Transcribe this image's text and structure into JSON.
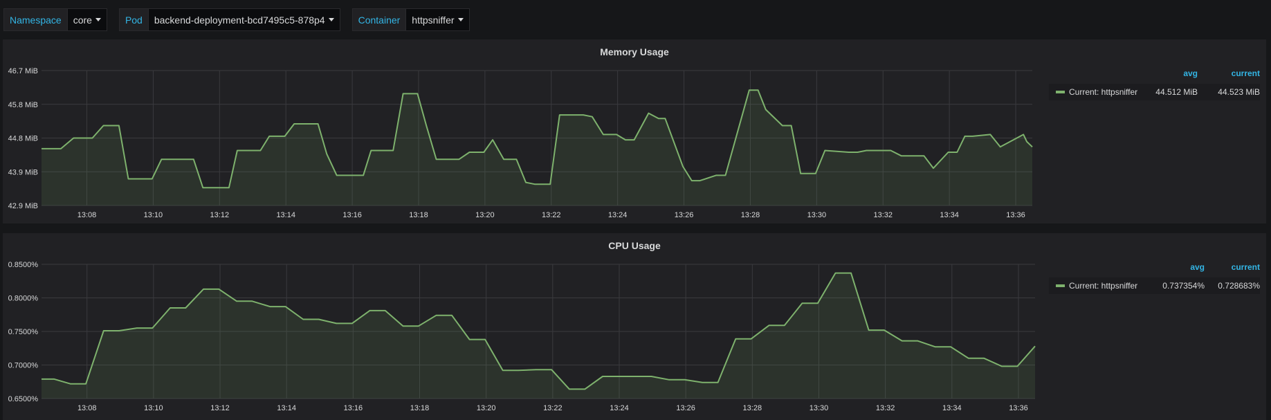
{
  "variables": [
    {
      "label": "Namespace",
      "value": "core"
    },
    {
      "label": "Pod",
      "value": "backend-deployment-bcd7495c5-878p4"
    },
    {
      "label": "Container",
      "value": "httpsniffer"
    }
  ],
  "colors": {
    "series": "#7eb26d",
    "accent": "#33b5e5",
    "grid": "#3a3a3e"
  },
  "legend_headers": {
    "avg": "avg",
    "current": "current"
  },
  "chart_data": [
    {
      "type": "area",
      "title": "Memory Usage",
      "x_ticks": [
        "13:08",
        "13:10",
        "13:12",
        "13:14",
        "13:16",
        "13:18",
        "13:20",
        "13:22",
        "13:24",
        "13:26",
        "13:28",
        "13:30",
        "13:32",
        "13:34",
        "13:36"
      ],
      "y_ticks": [
        "42.9 MiB",
        "43.9 MiB",
        "44.8 MiB",
        "45.8 MiB",
        "46.7 MiB"
      ],
      "ylim": [
        42.9,
        46.7
      ],
      "xlim": [
        "13:06:38",
        "13:36:30"
      ],
      "series": [
        {
          "name": "Current: httpsniffer",
          "avg": "44.512 MiB",
          "current": "44.523 MiB",
          "x": [
            "13:06:38",
            "13:07:13",
            "13:07:36",
            "13:08:10",
            "13:08:30",
            "13:08:58",
            "13:09:15",
            "13:09:58",
            "13:10:15",
            "13:11:13",
            "13:11:30",
            "13:12:17",
            "13:12:32",
            "13:13:14",
            "13:13:30",
            "13:13:58",
            "13:14:15",
            "13:14:58",
            "13:15:14",
            "13:15:32",
            "13:16:20",
            "13:16:34",
            "13:17:14",
            "13:17:32",
            "13:17:58",
            "13:18:14",
            "13:18:32",
            "13:19:13",
            "13:19:32",
            "13:19:58",
            "13:20:14",
            "13:20:34",
            "13:20:57",
            "13:21:14",
            "13:21:30",
            "13:21:58",
            "13:22:15",
            "13:22:58",
            "13:23:14",
            "13:23:34",
            "13:23:58",
            "13:24:14",
            "13:24:30",
            "13:24:56",
            "13:25:14",
            "13:25:26",
            "13:25:58",
            "13:26:14",
            "13:26:29",
            "13:26:58",
            "13:27:15",
            "13:27:58",
            "13:28:14",
            "13:28:28",
            "13:28:58",
            "13:29:14",
            "13:29:31",
            "13:29:58",
            "13:30:15",
            "13:30:58",
            "13:31:14",
            "13:31:30",
            "13:32:14",
            "13:32:33",
            "13:33:14",
            "13:33:31",
            "13:33:58",
            "13:34:14",
            "13:34:28",
            "13:34:42",
            "13:35:14",
            "13:35:32",
            "13:36:14",
            "13:36:20",
            "13:36:30"
          ],
          "values": [
            44.5,
            44.5,
            44.8,
            44.8,
            45.15,
            45.15,
            43.65,
            43.65,
            44.2,
            44.2,
            43.4,
            43.4,
            44.45,
            44.45,
            44.85,
            44.85,
            45.2,
            45.2,
            44.35,
            43.75,
            43.75,
            44.45,
            44.45,
            46.05,
            46.05,
            45.15,
            44.2,
            44.2,
            44.4,
            44.4,
            44.75,
            44.2,
            44.2,
            43.55,
            43.5,
            43.5,
            45.45,
            45.45,
            45.4,
            44.9,
            44.9,
            44.75,
            44.75,
            45.5,
            45.35,
            45.35,
            44.0,
            43.6,
            43.6,
            43.75,
            43.75,
            46.15,
            46.15,
            45.6,
            45.15,
            45.15,
            43.8,
            43.8,
            44.45,
            44.4,
            44.4,
            44.45,
            44.45,
            44.3,
            44.3,
            43.95,
            44.4,
            44.4,
            44.85,
            44.85,
            44.9,
            44.55,
            44.9,
            44.7,
            44.55
          ]
        }
      ]
    },
    {
      "type": "area",
      "title": "CPU Usage",
      "x_ticks": [
        "13:08",
        "13:10",
        "13:12",
        "13:14",
        "13:16",
        "13:18",
        "13:20",
        "13:22",
        "13:24",
        "13:26",
        "13:28",
        "13:30",
        "13:32",
        "13:34",
        "13:36"
      ],
      "y_ticks": [
        "0.6500%",
        "0.7000%",
        "0.7500%",
        "0.8000%",
        "0.8500%"
      ],
      "ylim": [
        0.65,
        0.85
      ],
      "xlim": [
        "13:06:38",
        "13:36:30"
      ],
      "series": [
        {
          "name": "Current: httpsniffer",
          "avg": "0.737354%",
          "current": "0.728683%",
          "x": [
            "13:06:38",
            "13:07:01",
            "13:07:30",
            "13:07:58",
            "13:08:30",
            "13:08:58",
            "13:09:30",
            "13:09:58",
            "13:10:30",
            "13:10:58",
            "13:11:30",
            "13:11:58",
            "13:12:30",
            "13:12:58",
            "13:13:30",
            "13:13:58",
            "13:14:30",
            "13:14:58",
            "13:15:30",
            "13:15:58",
            "13:16:30",
            "13:16:58",
            "13:17:30",
            "13:17:58",
            "13:18:30",
            "13:18:58",
            "13:19:30",
            "13:19:58",
            "13:20:30",
            "13:20:58",
            "13:21:30",
            "13:21:58",
            "13:22:30",
            "13:22:58",
            "13:23:30",
            "13:23:58",
            "13:24:30",
            "13:24:58",
            "13:25:30",
            "13:25:58",
            "13:26:30",
            "13:26:58",
            "13:27:30",
            "13:27:58",
            "13:28:30",
            "13:28:58",
            "13:29:30",
            "13:29:58",
            "13:30:30",
            "13:30:58",
            "13:31:30",
            "13:31:58",
            "13:32:30",
            "13:32:58",
            "13:33:30",
            "13:33:58",
            "13:34:30",
            "13:34:58",
            "13:35:30",
            "13:35:58",
            "13:36:30"
          ],
          "values": [
            0.679,
            0.679,
            0.672,
            0.672,
            0.751,
            0.751,
            0.755,
            0.755,
            0.785,
            0.785,
            0.813,
            0.813,
            0.795,
            0.795,
            0.787,
            0.787,
            0.768,
            0.768,
            0.762,
            0.762,
            0.781,
            0.781,
            0.758,
            0.758,
            0.774,
            0.774,
            0.738,
            0.738,
            0.692,
            0.692,
            0.693,
            0.693,
            0.664,
            0.664,
            0.683,
            0.683,
            0.683,
            0.683,
            0.678,
            0.678,
            0.674,
            0.674,
            0.739,
            0.739,
            0.759,
            0.759,
            0.792,
            0.792,
            0.837,
            0.837,
            0.752,
            0.752,
            0.736,
            0.736,
            0.727,
            0.727,
            0.71,
            0.71,
            0.698,
            0.698,
            0.728
          ]
        }
      ]
    }
  ]
}
